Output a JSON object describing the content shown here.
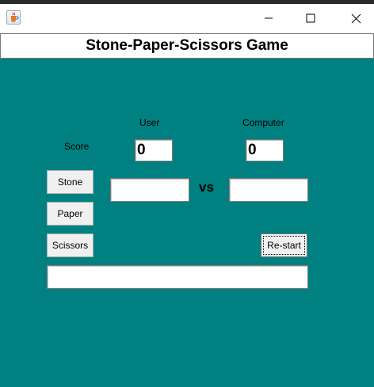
{
  "window": {
    "title": "",
    "icon": "java-cup-icon",
    "controls": [
      "minimize-icon",
      "maximize-icon",
      "close-icon"
    ]
  },
  "header": {
    "title": "Stone-Paper-Scissors Game"
  },
  "labels": {
    "user": "User",
    "computer": "Computer",
    "score": "Score",
    "vs": "vs"
  },
  "scores": {
    "user": "0",
    "computer": "0"
  },
  "choices": {
    "user": "",
    "computer": ""
  },
  "result": "",
  "buttons": {
    "stone": "Stone",
    "paper": "Paper",
    "scissors": "Scissors",
    "restart": "Re-start"
  },
  "colors": {
    "panel_background": "#008080",
    "field_background": "#ffffff",
    "button_background": "#f0f0f0"
  }
}
